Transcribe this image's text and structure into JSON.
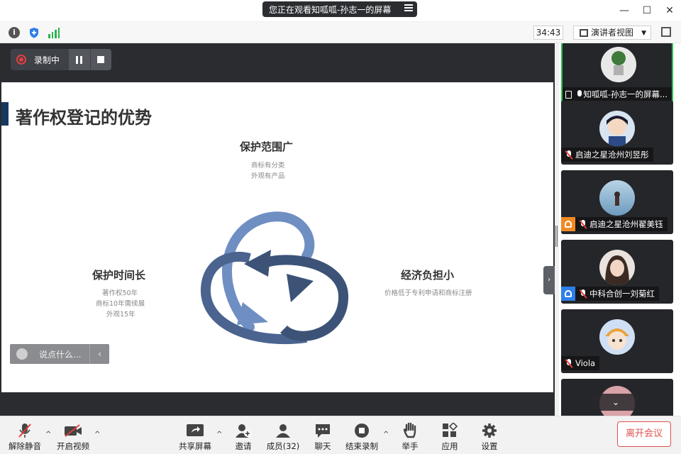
{
  "titlebar": {
    "sharing_banner": "您正在观看知呱呱-孙志一的屏幕",
    "minimize": "—",
    "maximize": "☐",
    "close": "✕"
  },
  "infobar": {
    "info_icon": "i",
    "timer": "34:43",
    "view_label": "演讲者视图",
    "view_caret": "▼"
  },
  "recording": {
    "label": "录制中"
  },
  "slide": {
    "title": "著作权登记的优势",
    "top": {
      "title": "保护范围广",
      "lines": [
        "商标有分类",
        "外观有产品"
      ]
    },
    "left": {
      "title": "保护时间长",
      "lines": [
        "著作权50年",
        "商标10年需续展",
        "外观15年"
      ]
    },
    "right": {
      "title": "经济负担小",
      "lines": [
        "价格低于专利申请和商标注册"
      ]
    }
  },
  "chat_hint": {
    "placeholder": "说点什么...",
    "arrow": "‹"
  },
  "side_toggle": "›",
  "participants": [
    {
      "name": "知呱呱-孙志一的屏幕...",
      "active": true,
      "sharing": true,
      "muted": false,
      "host_icon": "",
      "avatar": "plant-avatar"
    },
    {
      "name": "启迪之星沧州刘昱彤",
      "active": false,
      "sharing": false,
      "muted": true,
      "host_icon": "",
      "avatar": "anime-boy-avatar"
    },
    {
      "name": "启迪之星沧州翟美钰",
      "active": false,
      "sharing": false,
      "muted": true,
      "host_icon": "orange",
      "avatar": "sea-avatar"
    },
    {
      "name": "中科合创一刘菊红",
      "active": false,
      "sharing": false,
      "muted": true,
      "host_icon": "blue",
      "avatar": "girl-avatar"
    },
    {
      "name": "Viola",
      "active": false,
      "sharing": false,
      "muted": true,
      "host_icon": "",
      "avatar": "cartoon-avatar"
    }
  ],
  "participants_scroll": "⌄",
  "controls": {
    "unmute": "解除静音",
    "start_video": "开启视频",
    "share_screen": "共享屏幕",
    "invite": "邀请",
    "members": "成员(32)",
    "chat": "聊天",
    "end_recording": "结束录制",
    "raise_hand": "举手",
    "apps": "应用",
    "settings": "设置",
    "leave": "离开会议",
    "caret": "^"
  },
  "colors": {
    "accent_green": "#2bbf4d",
    "record_red": "#e63e3e",
    "leave_red": "#e05151",
    "slide_navy": "#17385e",
    "arrow_blue_light": "#6f8fc3",
    "arrow_blue_dark": "#3c5377"
  }
}
